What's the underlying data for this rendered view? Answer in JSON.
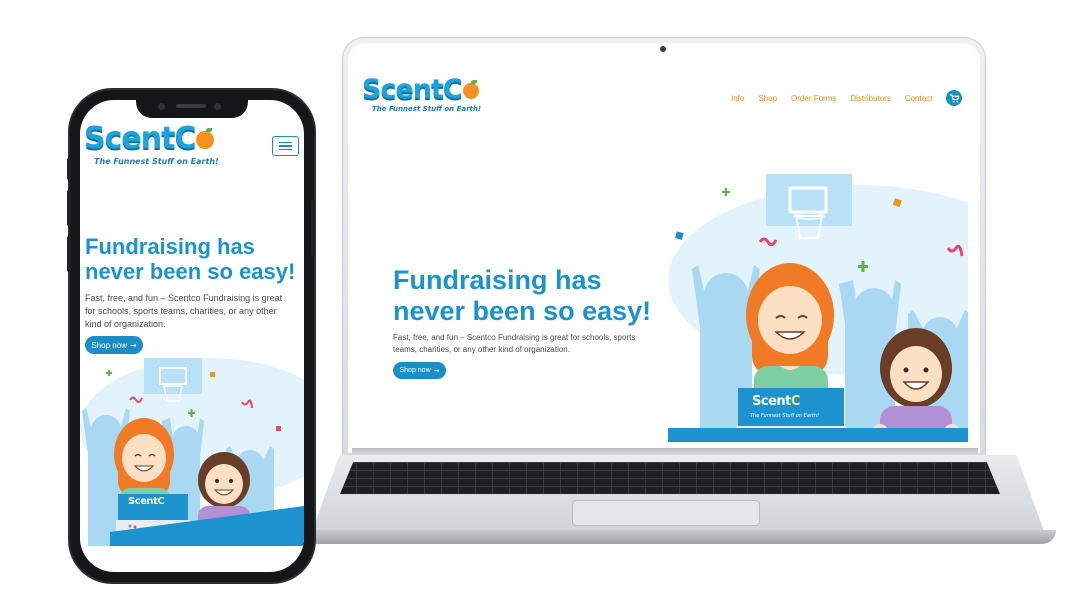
{
  "brand": {
    "name_main": "Scent",
    "name_end": "C",
    "tagline": "The Funnest Stuff on Earth!"
  },
  "nav": {
    "items": [
      "Info",
      "Shop",
      "Order Forms",
      "Distributors",
      "Contact"
    ],
    "cart_icon": "shopping-cart-icon"
  },
  "hero": {
    "title_line1": "Fundraising has",
    "title_line2": "never been so easy!",
    "description": "Fast, free, and fun – Scentco Fundraising is great for schools, sports teams, charities, or any other kind of organization.",
    "cta_label": "Shop now",
    "cta_icon": "arrow-right-icon"
  },
  "illustration": {
    "box_logo_main": "Scent",
    "box_logo_end": "C",
    "box_tagline": "The Funnest Stuff on Earth!"
  },
  "colors": {
    "brand_blue": "#1c93cf",
    "button_blue": "#1c8ec6",
    "nav_orange": "#e98a1e",
    "illus_light_blue": "#a9d8f3",
    "illus_bg": "#e3f3fc"
  }
}
